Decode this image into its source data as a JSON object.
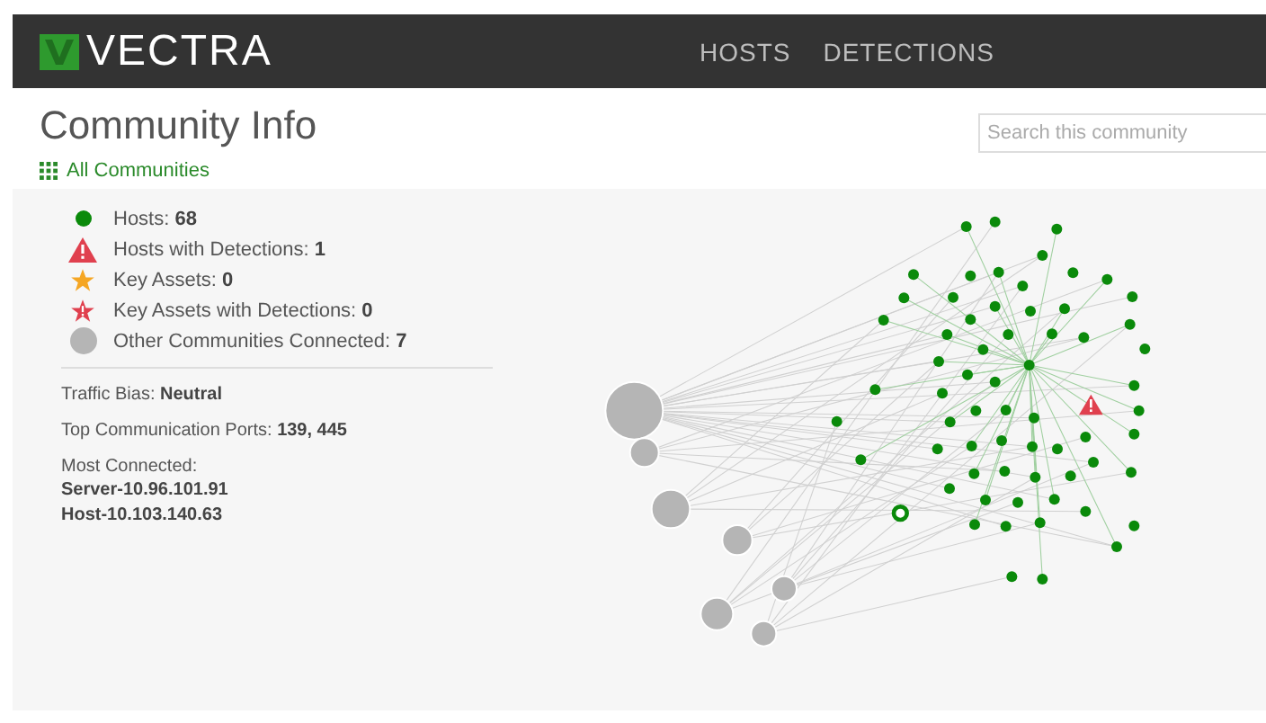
{
  "header": {
    "logo": "VECTRA",
    "nav": [
      "HOSTS",
      "DETECTIONS"
    ]
  },
  "title": "Community Info",
  "back_link": "All Communities",
  "search": {
    "placeholder": "Search this community"
  },
  "legend": [
    {
      "kind": "host",
      "label": "Hosts:",
      "value": "68"
    },
    {
      "kind": "host_detection",
      "label": "Hosts with Detections:",
      "value": "1"
    },
    {
      "kind": "key_asset",
      "label": "Key Assets:",
      "value": "0"
    },
    {
      "kind": "key_asset_detection",
      "label": "Key Assets with Detections:",
      "value": "0"
    },
    {
      "kind": "other_community",
      "label": "Other Communities Connected:",
      "value": "7"
    }
  ],
  "traffic_bias": {
    "label": "Traffic Bias:",
    "value": "Neutral"
  },
  "top_ports": {
    "label": "Top Communication Ports:",
    "value": "139, 445"
  },
  "most_connected": {
    "label": "Most Connected:",
    "hosts": [
      "Server-10.96.101.91",
      "Host-10.103.140.63"
    ]
  }
}
